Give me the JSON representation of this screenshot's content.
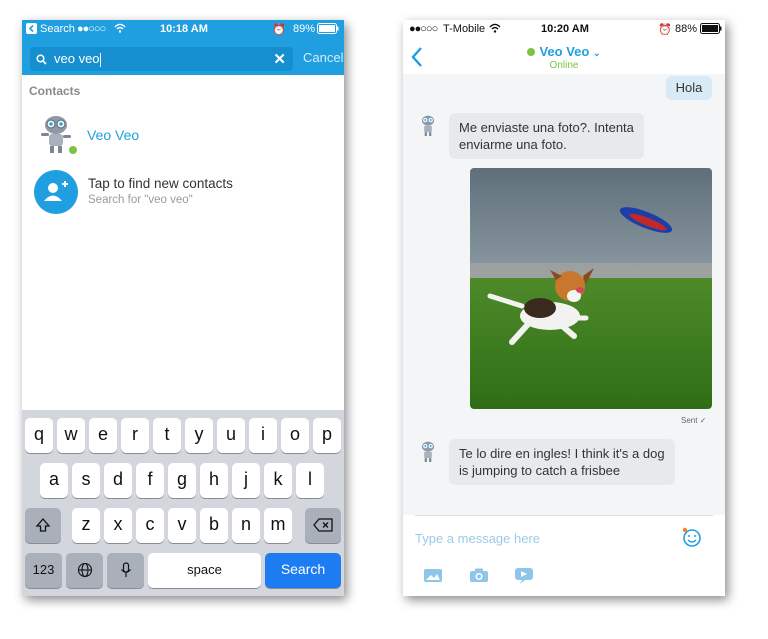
{
  "left": {
    "status": {
      "carrier": "Search",
      "time": "10:18 AM",
      "battery": "89%"
    },
    "search": {
      "value": "veo veo",
      "cancel": "Cancel"
    },
    "section": "Contacts",
    "contact": {
      "name": "Veo Veo"
    },
    "find": {
      "title": "Tap to find new contacts",
      "subtitle": "Search for \"veo veo\""
    },
    "keyboard": {
      "row1": [
        "q",
        "w",
        "e",
        "r",
        "t",
        "y",
        "u",
        "i",
        "o",
        "p"
      ],
      "row2": [
        "a",
        "s",
        "d",
        "f",
        "g",
        "h",
        "j",
        "k",
        "l"
      ],
      "row3": [
        "z",
        "x",
        "c",
        "v",
        "b",
        "n",
        "m"
      ],
      "num": "123",
      "space": "space",
      "search": "Search"
    }
  },
  "right": {
    "status": {
      "carrier": "T-Mobile",
      "time": "10:20 AM",
      "battery": "88%"
    },
    "header": {
      "name": "Veo Veo",
      "presence": "Online"
    },
    "messages": {
      "hola": "Hola",
      "in1_l1": "Me enviaste una foto?. Intenta",
      "in1_l2": "enviarme una foto.",
      "sent": "Sent",
      "in2_l1": "Te lo dire en ingles! I think it's a dog",
      "in2_l2": "is jumping to catch a frisbee"
    },
    "composer": {
      "placeholder": "Type a message here"
    }
  },
  "colors": {
    "accent": "#1f9fe0",
    "online": "#7dc242",
    "keyboard_bg": "#d3d6dc",
    "search_key": "#1e7cf2"
  }
}
